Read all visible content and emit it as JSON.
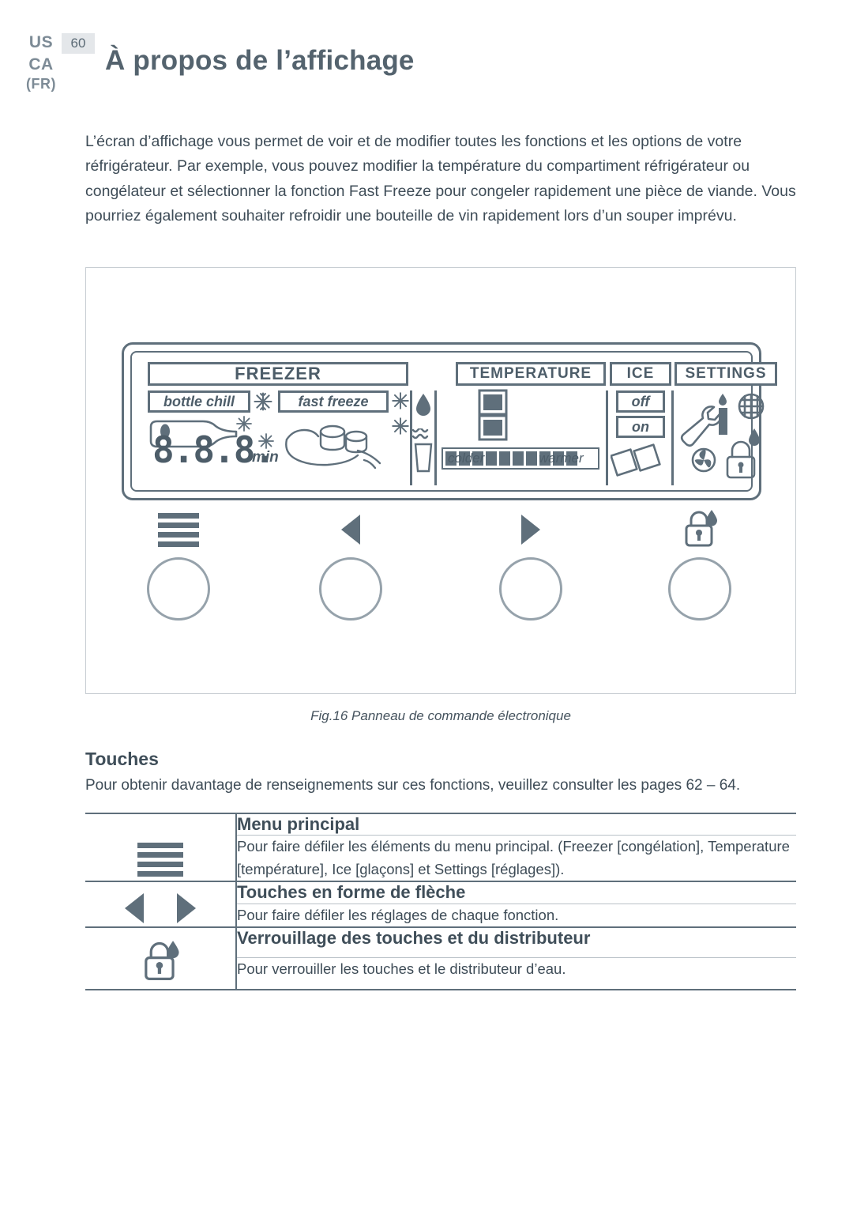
{
  "header": {
    "locales": [
      "US",
      "CA",
      "(FR)"
    ],
    "page_number": "60",
    "title": "À propos de l’affichage"
  },
  "intro": "L’écran d’affichage vous permet de voir et de modifier toutes les fonctions et les options de votre réfrigérateur. Par exemple, vous pouvez modifier la température du compartiment réfrigérateur ou congélateur et sélectionner la fonction Fast Freeze pour congeler rapidement une pièce de viande. Vous pourriez également souhaiter refroidir une bouteille de vin rapidement lors d’un souper imprévu.",
  "panel": {
    "headers": {
      "freezer": "FREEZER",
      "temperature": "TEMPERATURE",
      "ice": "ICE",
      "settings": "SETTINGS"
    },
    "freezer": {
      "bottle_chill": "bottle chill",
      "fast_freeze": "fast freeze",
      "timer_digits": "8.8.8.",
      "timer_unit": "min"
    },
    "temperature": {
      "colder": "colder",
      "warmer": "warmer",
      "bars": 10
    },
    "ice": {
      "off": "off",
      "on": "on"
    }
  },
  "buttons": [
    {
      "name": "menu-button",
      "glyph": "menu"
    },
    {
      "name": "left-arrow-button",
      "glyph": "left"
    },
    {
      "name": "right-arrow-button",
      "glyph": "right"
    },
    {
      "name": "lock-button",
      "glyph": "lock"
    }
  ],
  "figure_caption": "Fig.16 Panneau de commande électronique",
  "touches": {
    "title": "Touches",
    "subtitle": "Pour obtenir davantage de renseignements sur ces fonctions, veuillez consulter les pages 62 – 64.",
    "rows": [
      {
        "icon": "menu-icon",
        "heading": "Menu principal",
        "body": "Pour faire défiler les éléments du menu principal. (Freezer [congélation], Temperature [température], Ice [glaçons] et Settings [réglages])."
      },
      {
        "icon": "arrow-keys-icon",
        "heading": "Touches en forme de flèche",
        "body": "Pour faire défiler les réglages de chaque fonction."
      },
      {
        "icon": "lock-icon",
        "heading": "Verrouillage des touches et du distributeur",
        "body": "Pour verrouiller les touches et le distributeur d’eau."
      }
    ]
  }
}
